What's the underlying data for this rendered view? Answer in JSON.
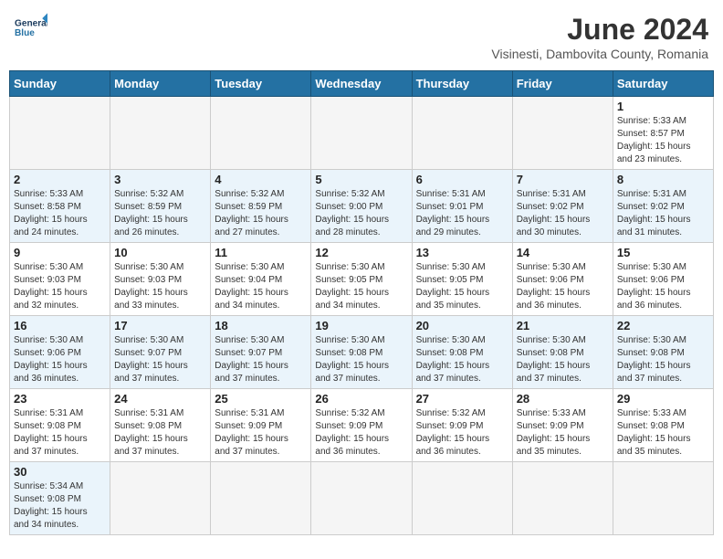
{
  "header": {
    "logo_general": "General",
    "logo_blue": "Blue",
    "month_title": "June 2024",
    "subtitle": "Visinesti, Dambovita County, Romania"
  },
  "days_of_week": [
    "Sunday",
    "Monday",
    "Tuesday",
    "Wednesday",
    "Thursday",
    "Friday",
    "Saturday"
  ],
  "weeks": [
    {
      "row_class": "row-odd",
      "days": [
        {
          "num": "",
          "info": "",
          "empty": true
        },
        {
          "num": "",
          "info": "",
          "empty": true
        },
        {
          "num": "",
          "info": "",
          "empty": true
        },
        {
          "num": "",
          "info": "",
          "empty": true
        },
        {
          "num": "",
          "info": "",
          "empty": true
        },
        {
          "num": "",
          "info": "",
          "empty": true
        },
        {
          "num": "1",
          "info": "Sunrise: 5:33 AM\nSunset: 8:57 PM\nDaylight: 15 hours\nand 23 minutes.",
          "empty": false
        }
      ]
    },
    {
      "row_class": "row-even",
      "days": [
        {
          "num": "2",
          "info": "Sunrise: 5:33 AM\nSunset: 8:58 PM\nDaylight: 15 hours\nand 24 minutes.",
          "empty": false
        },
        {
          "num": "3",
          "info": "Sunrise: 5:32 AM\nSunset: 8:59 PM\nDaylight: 15 hours\nand 26 minutes.",
          "empty": false
        },
        {
          "num": "4",
          "info": "Sunrise: 5:32 AM\nSunset: 8:59 PM\nDaylight: 15 hours\nand 27 minutes.",
          "empty": false
        },
        {
          "num": "5",
          "info": "Sunrise: 5:32 AM\nSunset: 9:00 PM\nDaylight: 15 hours\nand 28 minutes.",
          "empty": false
        },
        {
          "num": "6",
          "info": "Sunrise: 5:31 AM\nSunset: 9:01 PM\nDaylight: 15 hours\nand 29 minutes.",
          "empty": false
        },
        {
          "num": "7",
          "info": "Sunrise: 5:31 AM\nSunset: 9:02 PM\nDaylight: 15 hours\nand 30 minutes.",
          "empty": false
        },
        {
          "num": "8",
          "info": "Sunrise: 5:31 AM\nSunset: 9:02 PM\nDaylight: 15 hours\nand 31 minutes.",
          "empty": false
        }
      ]
    },
    {
      "row_class": "row-odd",
      "days": [
        {
          "num": "9",
          "info": "Sunrise: 5:30 AM\nSunset: 9:03 PM\nDaylight: 15 hours\nand 32 minutes.",
          "empty": false
        },
        {
          "num": "10",
          "info": "Sunrise: 5:30 AM\nSunset: 9:03 PM\nDaylight: 15 hours\nand 33 minutes.",
          "empty": false
        },
        {
          "num": "11",
          "info": "Sunrise: 5:30 AM\nSunset: 9:04 PM\nDaylight: 15 hours\nand 34 minutes.",
          "empty": false
        },
        {
          "num": "12",
          "info": "Sunrise: 5:30 AM\nSunset: 9:05 PM\nDaylight: 15 hours\nand 34 minutes.",
          "empty": false
        },
        {
          "num": "13",
          "info": "Sunrise: 5:30 AM\nSunset: 9:05 PM\nDaylight: 15 hours\nand 35 minutes.",
          "empty": false
        },
        {
          "num": "14",
          "info": "Sunrise: 5:30 AM\nSunset: 9:06 PM\nDaylight: 15 hours\nand 36 minutes.",
          "empty": false
        },
        {
          "num": "15",
          "info": "Sunrise: 5:30 AM\nSunset: 9:06 PM\nDaylight: 15 hours\nand 36 minutes.",
          "empty": false
        }
      ]
    },
    {
      "row_class": "row-even",
      "days": [
        {
          "num": "16",
          "info": "Sunrise: 5:30 AM\nSunset: 9:06 PM\nDaylight: 15 hours\nand 36 minutes.",
          "empty": false
        },
        {
          "num": "17",
          "info": "Sunrise: 5:30 AM\nSunset: 9:07 PM\nDaylight: 15 hours\nand 37 minutes.",
          "empty": false
        },
        {
          "num": "18",
          "info": "Sunrise: 5:30 AM\nSunset: 9:07 PM\nDaylight: 15 hours\nand 37 minutes.",
          "empty": false
        },
        {
          "num": "19",
          "info": "Sunrise: 5:30 AM\nSunset: 9:08 PM\nDaylight: 15 hours\nand 37 minutes.",
          "empty": false
        },
        {
          "num": "20",
          "info": "Sunrise: 5:30 AM\nSunset: 9:08 PM\nDaylight: 15 hours\nand 37 minutes.",
          "empty": false
        },
        {
          "num": "21",
          "info": "Sunrise: 5:30 AM\nSunset: 9:08 PM\nDaylight: 15 hours\nand 37 minutes.",
          "empty": false
        },
        {
          "num": "22",
          "info": "Sunrise: 5:30 AM\nSunset: 9:08 PM\nDaylight: 15 hours\nand 37 minutes.",
          "empty": false
        }
      ]
    },
    {
      "row_class": "row-odd",
      "days": [
        {
          "num": "23",
          "info": "Sunrise: 5:31 AM\nSunset: 9:08 PM\nDaylight: 15 hours\nand 37 minutes.",
          "empty": false
        },
        {
          "num": "24",
          "info": "Sunrise: 5:31 AM\nSunset: 9:08 PM\nDaylight: 15 hours\nand 37 minutes.",
          "empty": false
        },
        {
          "num": "25",
          "info": "Sunrise: 5:31 AM\nSunset: 9:09 PM\nDaylight: 15 hours\nand 37 minutes.",
          "empty": false
        },
        {
          "num": "26",
          "info": "Sunrise: 5:32 AM\nSunset: 9:09 PM\nDaylight: 15 hours\nand 36 minutes.",
          "empty": false
        },
        {
          "num": "27",
          "info": "Sunrise: 5:32 AM\nSunset: 9:09 PM\nDaylight: 15 hours\nand 36 minutes.",
          "empty": false
        },
        {
          "num": "28",
          "info": "Sunrise: 5:33 AM\nSunset: 9:09 PM\nDaylight: 15 hours\nand 35 minutes.",
          "empty": false
        },
        {
          "num": "29",
          "info": "Sunrise: 5:33 AM\nSunset: 9:08 PM\nDaylight: 15 hours\nand 35 minutes.",
          "empty": false
        }
      ]
    },
    {
      "row_class": "row-even",
      "days": [
        {
          "num": "30",
          "info": "Sunrise: 5:34 AM\nSunset: 9:08 PM\nDaylight: 15 hours\nand 34 minutes.",
          "empty": false
        },
        {
          "num": "",
          "info": "",
          "empty": true
        },
        {
          "num": "",
          "info": "",
          "empty": true
        },
        {
          "num": "",
          "info": "",
          "empty": true
        },
        {
          "num": "",
          "info": "",
          "empty": true
        },
        {
          "num": "",
          "info": "",
          "empty": true
        },
        {
          "num": "",
          "info": "",
          "empty": true
        }
      ]
    }
  ]
}
